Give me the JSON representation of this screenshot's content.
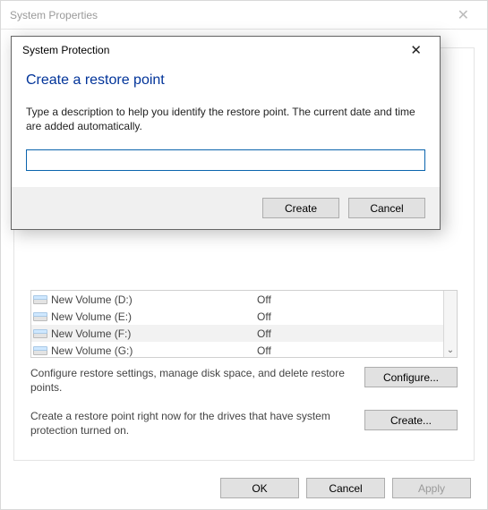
{
  "sysprops": {
    "title": "System Properties",
    "close_glyph": "✕",
    "drives": [
      {
        "name": "New Volume (D:)",
        "protection": "Off"
      },
      {
        "name": "New Volume (E:)",
        "protection": "Off"
      },
      {
        "name": "New Volume (F:)",
        "protection": "Off",
        "selected": true
      },
      {
        "name": "New Volume (G:)",
        "protection": "Off"
      }
    ],
    "configure_text": "Configure restore settings, manage disk space, and delete restore points.",
    "configure_label": "Configure...",
    "create_text": "Create a restore point right now for the drives that have system protection turned on.",
    "create_label": "Create...",
    "ok_label": "OK",
    "cancel_label": "Cancel",
    "apply_label": "Apply"
  },
  "modal": {
    "title": "System Protection",
    "close_glyph": "✕",
    "heading": "Create a restore point",
    "body_text": "Type a description to help you identify the restore point. The current date and time are added automatically.",
    "input_value": "",
    "input_placeholder": "",
    "create_label": "Create",
    "cancel_label": "Cancel"
  }
}
